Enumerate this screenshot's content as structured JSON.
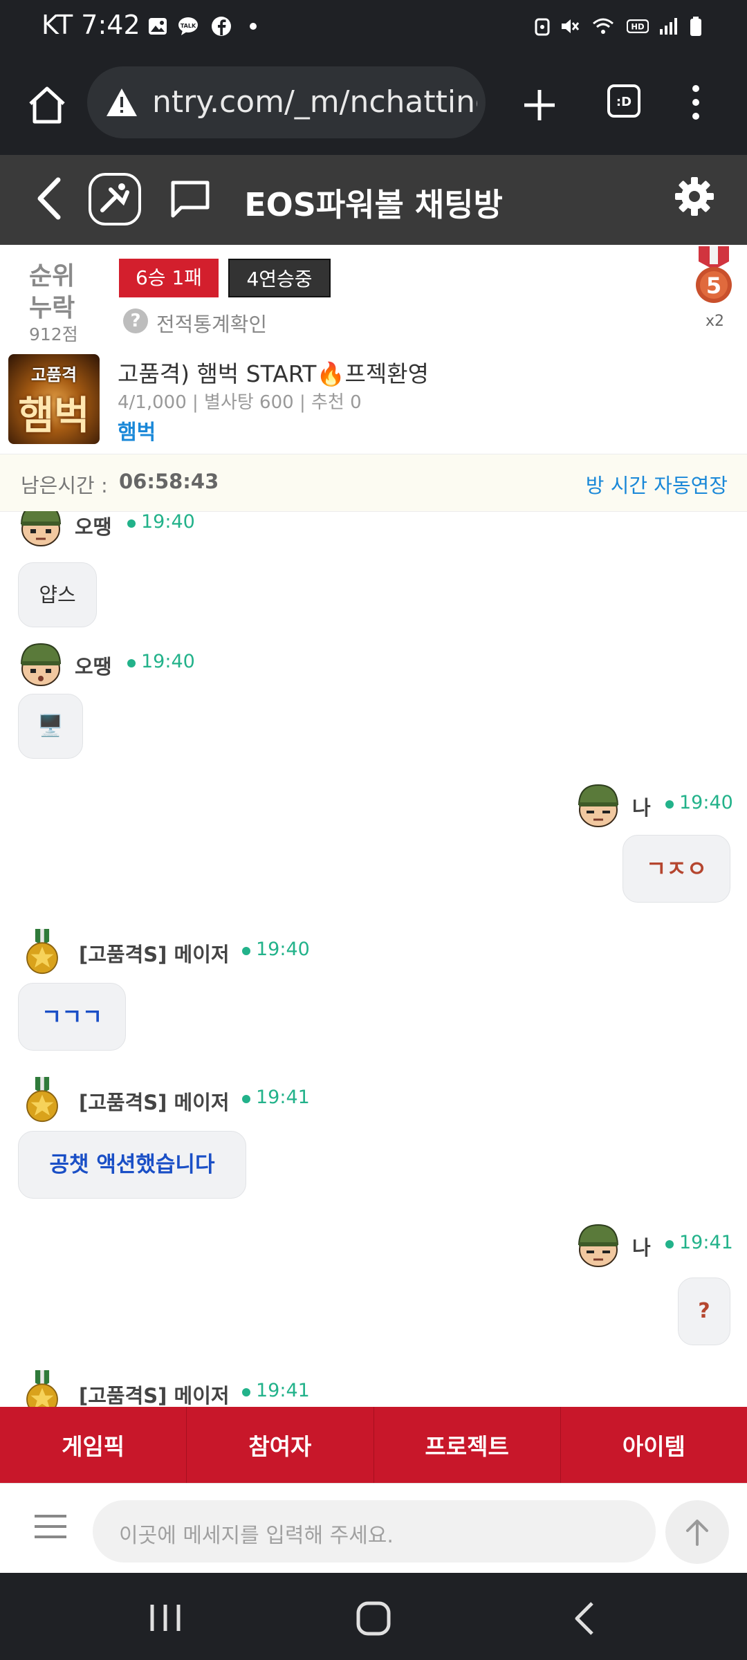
{
  "status_bar": {
    "carrier": "KT",
    "time": "7:42"
  },
  "browser": {
    "url": "ntry.com/_m/nchatting"
  },
  "app_header": {
    "title": "EOS파워볼 채팅방"
  },
  "profile": {
    "rank_line1": "순위",
    "rank_line2": "누락",
    "points": "912점",
    "record_badge": "6승 1패",
    "streak_badge": "4연승중",
    "stats_link": "전적통계확인",
    "medal_count": "x2"
  },
  "room": {
    "thumb_top": "고품격",
    "thumb_main": "햄벅",
    "name": "고품격) 햄벅 START🔥프젝환영",
    "meta": "4/1,000 | 별사탕 600 | 추천 0",
    "host": "햄벅"
  },
  "remaining": {
    "label": "남은시간 :",
    "value": "06:58:43",
    "extend": "방 시간 자동연장"
  },
  "messages": [
    {
      "user": "오땡",
      "time": "19:40",
      "text": "얍스",
      "side": "left",
      "avatar": "soldier",
      "text_color": "#333333"
    },
    {
      "user": "오땡",
      "time": "19:40",
      "text": "🖥️",
      "side": "left",
      "avatar": "soldier",
      "text_color": "#333333"
    },
    {
      "user": "나",
      "time": "19:40",
      "text": "ㄱㅈㅇ",
      "side": "right",
      "avatar": "soldier",
      "text_color": "#b5462f"
    },
    {
      "user": "[고품격S] 메이저",
      "time": "19:40",
      "text": "ㄱㄱㄱ",
      "side": "left",
      "avatar": "medal",
      "text_color": "#1a4fc6"
    },
    {
      "user": "[고품격S] 메이저",
      "time": "19:41",
      "text": "공챗 액션했습니다",
      "side": "left",
      "avatar": "medal",
      "text_color": "#1a4fc6"
    },
    {
      "user": "나",
      "time": "19:41",
      "text": "?",
      "side": "right",
      "avatar": "soldier",
      "text_color": "#b5462f"
    },
    {
      "user": "[고품격S] 메이저",
      "time": "19:41",
      "text": "",
      "side": "left",
      "avatar": "medal",
      "text_color": "#1a4fc6"
    }
  ],
  "bottom_menu": [
    "게임픽",
    "참여자",
    "프로젝트",
    "아이템"
  ],
  "input": {
    "placeholder": "이곳에 메세지를 입력해 주세요."
  },
  "colors": {
    "accent_red": "#c8172a",
    "link_blue": "#1a88d8",
    "online_green": "#22b28a"
  }
}
